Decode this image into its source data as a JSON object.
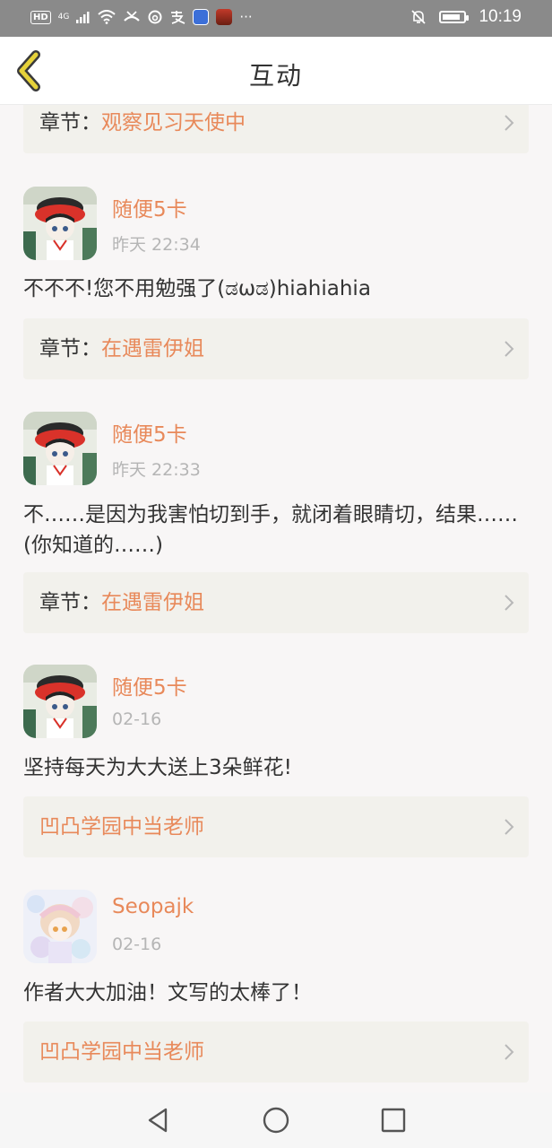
{
  "status_bar": {
    "hd": "HD",
    "signal_label": "4G",
    "more": "···",
    "time": "10:19",
    "battery_level": 0.85
  },
  "header": {
    "title": "互动",
    "back_icon": "chevron-left-icon"
  },
  "colors": {
    "accent": "#e8895a",
    "header_bg": "#ffffff",
    "page_bg": "#f8f6f6",
    "chapter_bg": "#f2f1ec",
    "back_icon": "#d9c23a"
  },
  "top_chapter": {
    "prefix": "章节：",
    "name": "观察见习天使中"
  },
  "comments": [
    {
      "avatar": "avatar-red-hood",
      "username": "随便5卡",
      "time": "昨天 22:34",
      "text": "不不不!您不用勉强了(ಡωಡ)hiahiahia",
      "chapter_prefix": "章节：",
      "chapter_name": "在遇雷伊姐"
    },
    {
      "avatar": "avatar-red-hood",
      "username": "随便5卡",
      "time": "昨天 22:33",
      "text": "不……是因为我害怕切到手，就闭着眼睛切，结果……(你知道的……)",
      "chapter_prefix": "章节：",
      "chapter_name": "在遇雷伊姐"
    },
    {
      "avatar": "avatar-red-hood",
      "username": "随便5卡",
      "time": "02-16",
      "text": "坚持每天为大大送上3朵鲜花!",
      "chapter_prefix": "",
      "chapter_name": "凹凸学园中当老师"
    },
    {
      "avatar": "avatar-pastel-girl",
      "username": "Seopajk",
      "time": "02-16",
      "text": "作者大大加油！文写的太棒了！",
      "chapter_prefix": "",
      "chapter_name": "凹凸学园中当老师"
    }
  ],
  "nav_bar": {
    "back": "triangle-back-icon",
    "home": "circle-home-icon",
    "recents": "square-recents-icon"
  }
}
